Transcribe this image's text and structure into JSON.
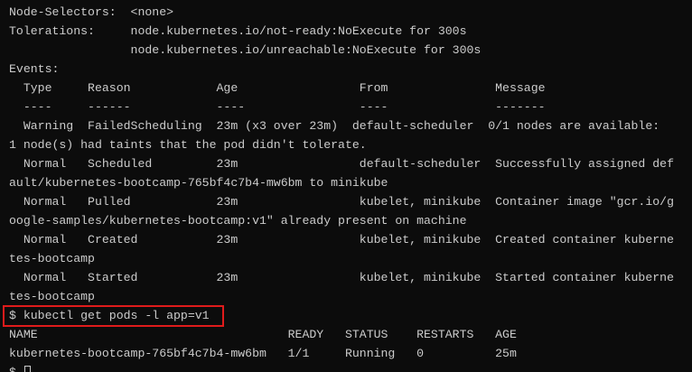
{
  "terminal": {
    "lines": [
      "Node-Selectors:  <none>",
      "Tolerations:     node.kubernetes.io/not-ready:NoExecute for 300s",
      "                 node.kubernetes.io/unreachable:NoExecute for 300s",
      "Events:",
      "  Type     Reason            Age                 From               Message",
      "  ----     ------            ----                ----               -------",
      "  Warning  FailedScheduling  23m (x3 over 23m)  default-scheduler  0/1 nodes are available:",
      "1 node(s) had taints that the pod didn't tolerate.",
      "  Normal   Scheduled         23m                 default-scheduler  Successfully assigned def",
      "ault/kubernetes-bootcamp-765bf4c7b4-mw6bm to minikube",
      "  Normal   Pulled            23m                 kubelet, minikube  Container image \"gcr.io/g",
      "oogle-samples/kubernetes-bootcamp:v1\" already present on machine",
      "  Normal   Created           23m                 kubelet, minikube  Created container kuberne",
      "tes-bootcamp",
      "  Normal   Started           23m                 kubelet, minikube  Started container kuberne",
      "tes-bootcamp",
      "$ kubectl get pods -l app=v1",
      "NAME                                   READY   STATUS    RESTARTS   AGE",
      "kubernetes-bootcamp-765bf4c7b4-mw6bm   1/1     Running   0          25m"
    ],
    "prompt": "$ "
  },
  "colors": {
    "background": "#0c0c0c",
    "foreground": "#cccccc",
    "highlight": "#e01b1b"
  }
}
